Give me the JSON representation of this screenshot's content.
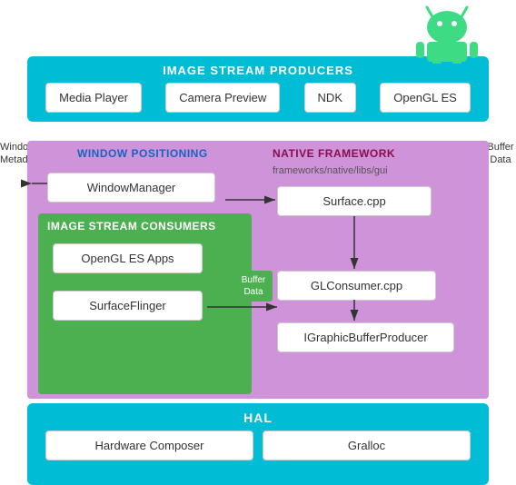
{
  "android_robot": {
    "alt": "Android Robot"
  },
  "image_stream_producers": {
    "title": "IMAGE STREAM PRODUCERS",
    "items": [
      {
        "label": "Media Player"
      },
      {
        "label": "Camera Preview"
      },
      {
        "label": "NDK"
      },
      {
        "label": "OpenGL ES"
      }
    ]
  },
  "window_positioning": {
    "title": "WINDOW POSITIONING",
    "window_manager": "WindowManager"
  },
  "native_framework": {
    "title": "NATIVE FRAMEWORK",
    "path": "frameworks/native/libs/gui",
    "surface_cpp": "Surface.cpp",
    "glconsumer": "GLConsumer.cpp",
    "igraphic": "IGraphicBufferProducer"
  },
  "image_stream_consumers": {
    "title": "IMAGE STREAM CONSUMERS",
    "opengl_apps": "OpenGL ES Apps",
    "surfaceflinger": "SurfaceFlinger"
  },
  "labels": {
    "window_metadata": "Window Metadata",
    "buffer_data": "Buffer Data"
  },
  "hal": {
    "title": "HAL",
    "items": [
      {
        "label": "Hardware Composer"
      },
      {
        "label": "Gralloc"
      }
    ]
  }
}
